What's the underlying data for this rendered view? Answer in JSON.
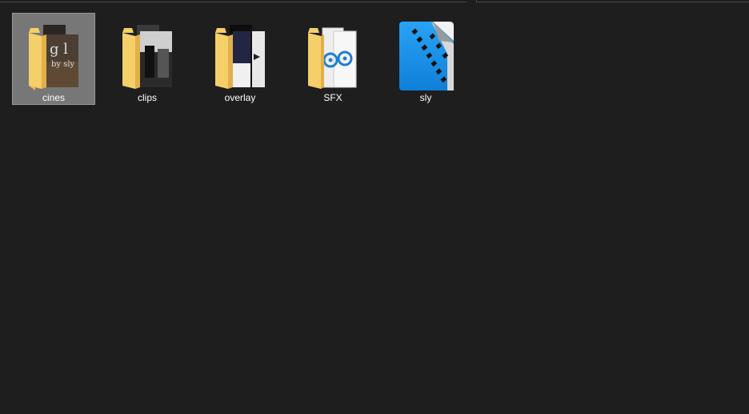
{
  "files": [
    {
      "label": "cines",
      "icon": "folder-photos-icon",
      "selected": true
    },
    {
      "label": "clips",
      "icon": "folder-photos-icon",
      "selected": false
    },
    {
      "label": "overlay",
      "icon": "folder-photos-icon",
      "selected": false
    },
    {
      "label": "SFX",
      "icon": "folder-audio-icon",
      "selected": false
    },
    {
      "label": "sly",
      "icon": "video-project-icon",
      "selected": false
    }
  ],
  "colors": {
    "background": "#1e1e1e",
    "selection": "#777777",
    "folder": "#f4cf6a",
    "project_blue": "#1e90e8"
  }
}
